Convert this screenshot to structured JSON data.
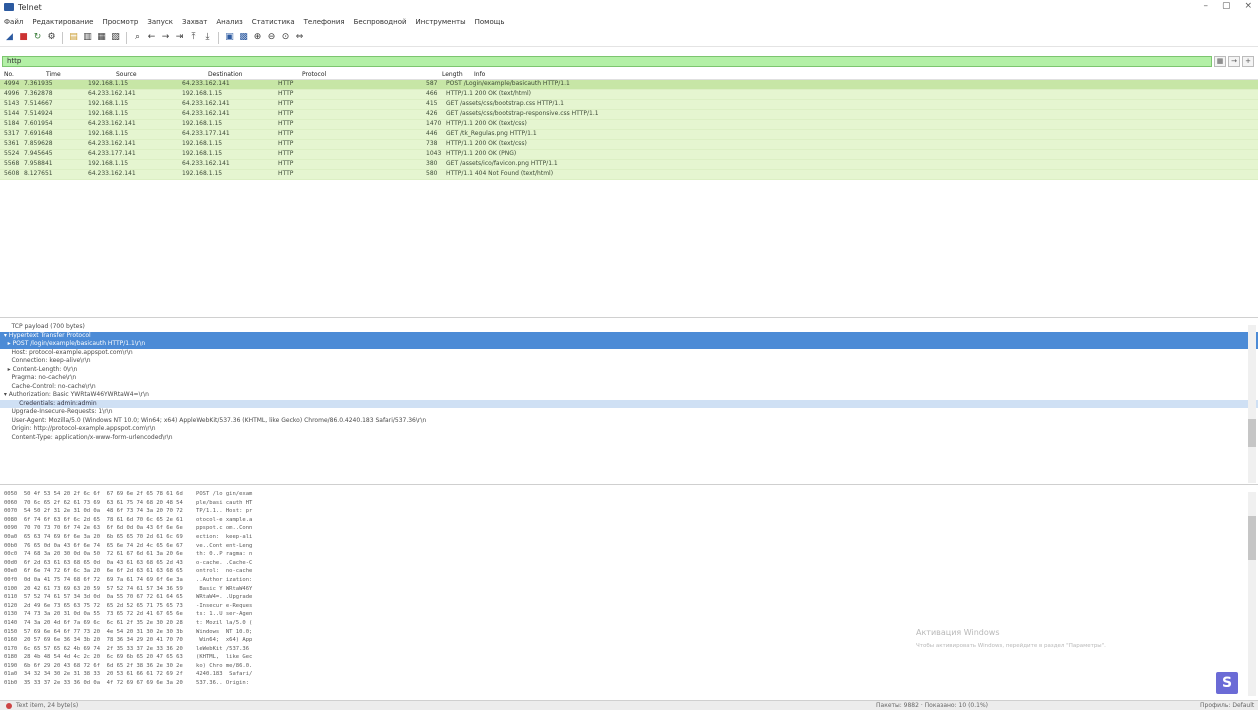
{
  "window": {
    "title": "Telnet",
    "controls": [
      "–",
      "▢",
      "×"
    ]
  },
  "menu": [
    "Файл",
    "Редактирование",
    "Просмотр",
    "Запуск",
    "Захват",
    "Анализ",
    "Статистика",
    "Телефония",
    "Беспроводной",
    "Инструменты",
    "Помощь"
  ],
  "toolbar": {
    "icons": [
      "shark-fin-icon",
      "stop-icon",
      "restart-icon",
      "options-icon",
      "open-icon",
      "save-icon",
      "close-file-icon",
      "reload-icon",
      "find-icon",
      "back-icon",
      "forward-icon",
      "goto-icon",
      "first-icon",
      "last-icon",
      "autoscroll-icon",
      "colorize-icon",
      "zoom-in-icon",
      "zoom-out-icon",
      "zoom-normal-icon",
      "resize-columns-icon"
    ]
  },
  "filter": {
    "value": "http",
    "buttons": [
      "▦",
      "→",
      "+"
    ]
  },
  "packet_list": {
    "columns": [
      "No.",
      "Time",
      "Source",
      "Destination",
      "Protocol",
      "Length",
      "Info"
    ],
    "rows": [
      {
        "no": "4994",
        "time": "7.361935",
        "src": "192.168.1.15",
        "dst": "64.233.162.141",
        "proto": "HTTP",
        "len": "587",
        "info": "POST /Login/example/basicauth HTTP/1.1"
      },
      {
        "no": "4996",
        "time": "7.362878",
        "src": "64.233.162.141",
        "dst": "192.168.1.15",
        "proto": "HTTP",
        "len": "466",
        "info": "HTTP/1.1 200 OK  (text/html)"
      },
      {
        "no": "5143",
        "time": "7.514667",
        "src": "192.168.1.15",
        "dst": "64.233.162.141",
        "proto": "HTTP",
        "len": "415",
        "info": "GET /assets/css/bootstrap.css HTTP/1.1"
      },
      {
        "no": "5144",
        "time": "7.514924",
        "src": "192.168.1.15",
        "dst": "64.233.162.141",
        "proto": "HTTP",
        "len": "426",
        "info": "GET /assets/css/bootstrap-responsive.css HTTP/1.1"
      },
      {
        "no": "5184",
        "time": "7.601954",
        "src": "64.233.162.141",
        "dst": "192.168.1.15",
        "proto": "HTTP",
        "len": "1470",
        "info": "HTTP/1.1 200 OK  (text/css)"
      },
      {
        "no": "5317",
        "time": "7.691648",
        "src": "192.168.1.15",
        "dst": "64.233.177.141",
        "proto": "HTTP",
        "len": "446",
        "info": "GET /tk_Regulas.png HTTP/1.1"
      },
      {
        "no": "5361",
        "time": "7.859628",
        "src": "64.233.162.141",
        "dst": "192.168.1.15",
        "proto": "HTTP",
        "len": "738",
        "info": "HTTP/1.1 200 OK  (text/css)"
      },
      {
        "no": "5524",
        "time": "7.945645",
        "src": "64.233.177.141",
        "dst": "192.168.1.15",
        "proto": "HTTP",
        "len": "1043",
        "info": "HTTP/1.1 200 OK  (PNG)"
      },
      {
        "no": "5568",
        "time": "7.958841",
        "src": "192.168.1.15",
        "dst": "64.233.162.141",
        "proto": "HTTP",
        "len": "380",
        "info": "GET /assets/ico/favicon.png HTTP/1.1"
      },
      {
        "no": "5608",
        "time": "8.127651",
        "src": "64.233.162.141",
        "dst": "192.168.1.15",
        "proto": "HTTP",
        "len": "580",
        "info": "HTTP/1.1 404 Not Found  (text/html)"
      }
    ]
  },
  "details": {
    "lines": [
      {
        "indent": "      ",
        "text": "TCP payload (700 bytes)",
        "cls": ""
      },
      {
        "indent": "  ▾ ",
        "text": "Hypertext Transfer Protocol",
        "cls": "hl"
      },
      {
        "indent": "    ▸ ",
        "text": "POST /login/example/basicauth HTTP/1.1\\r\\n",
        "cls": "hl"
      },
      {
        "indent": "      ",
        "text": "Host: protocol-example.appspot.com\\r\\n",
        "cls": ""
      },
      {
        "indent": "      ",
        "text": "Connection: keep-alive\\r\\n",
        "cls": ""
      },
      {
        "indent": "    ▸ ",
        "text": "Content-Length: 0\\r\\n",
        "cls": ""
      },
      {
        "indent": "      ",
        "text": "Pragma: no-cache\\r\\n",
        "cls": ""
      },
      {
        "indent": "      ",
        "text": "Cache-Control: no-cache\\r\\n",
        "cls": ""
      },
      {
        "indent": "  ▾ ",
        "text": "Authorization: Basic YWRtaW46YWRtaW4=\\r\\n",
        "cls": ""
      },
      {
        "indent": "          ",
        "text": "Credentials: admin:admin",
        "cls": "hl2"
      },
      {
        "indent": "      ",
        "text": "Upgrade-Insecure-Requests: 1\\r\\n",
        "cls": ""
      },
      {
        "indent": "      ",
        "text": "User-Agent: Mozilla/5.0 (Windows NT 10.0; Win64; x64) AppleWebKit/537.36 (KHTML, like Gecko) Chrome/86.0.4240.183 Safari/537.36\\r\\n",
        "cls": ""
      },
      {
        "indent": "      ",
        "text": "Origin: http://protocol-example.appspot.com\\r\\n",
        "cls": ""
      },
      {
        "indent": "      ",
        "text": "Content-Type: application/x-www-form-urlencoded\\r\\n",
        "cls": ""
      }
    ]
  },
  "bytes": {
    "lines": [
      "0050  50 4f 53 54 20 2f 6c 6f  67 69 6e 2f 65 78 61 6d    POST /lo gin/exam",
      "0060  70 6c 65 2f 62 61 73 69  63 61 75 74 68 20 48 54    ple/basi cauth HT",
      "0070  54 50 2f 31 2e 31 0d 0a  48 6f 73 74 3a 20 70 72    TP/1.1.. Host: pr",
      "0080  6f 74 6f 63 6f 6c 2d 65  78 61 6d 70 6c 65 2e 61    otocol-e xample.a",
      "0090  70 70 73 70 6f 74 2e 63  6f 6d 0d 0a 43 6f 6e 6e    ppspot.c om..Conn",
      "00a0  65 63 74 69 6f 6e 3a 20  6b 65 65 70 2d 61 6c 69    ection:  keep-ali",
      "00b0  76 65 0d 0a 43 6f 6e 74  65 6e 74 2d 4c 65 6e 67    ve..Cont ent-Leng",
      "00c0  74 68 3a 20 30 0d 0a 50  72 61 67 6d 61 3a 20 6e    th: 0..P ragma: n",
      "00d0  6f 2d 63 61 63 68 65 0d  0a 43 61 63 68 65 2d 43    o-cache. .Cache-C",
      "00e0  6f 6e 74 72 6f 6c 3a 20  6e 6f 2d 63 61 63 68 65    ontrol:  no-cache",
      "00f0  0d 0a 41 75 74 68 6f 72  69 7a 61 74 69 6f 6e 3a    ..Author ization:",
      "0100  20 42 61 73 69 63 20 59  57 52 74 61 57 34 36 59     Basic Y WRtaW46Y",
      "0110  57 52 74 61 57 34 3d 0d  0a 55 70 67 72 61 64 65    WRtaW4=. .Upgrade",
      "0120  2d 49 6e 73 65 63 75 72  65 2d 52 65 71 75 65 73    -Insecur e-Reques",
      "0130  74 73 3a 20 31 0d 0a 55  73 65 72 2d 41 67 65 6e    ts: 1..U ser-Agen",
      "0140  74 3a 20 4d 6f 7a 69 6c  6c 61 2f 35 2e 30 20 28    t: Mozil la/5.0 (",
      "0150  57 69 6e 64 6f 77 73 20  4e 54 20 31 30 2e 30 3b    Windows  NT 10.0;",
      "0160  20 57 69 6e 36 34 3b 20  78 36 34 29 20 41 70 70     Win64;  x64) App",
      "0170  6c 65 57 65 62 4b 69 74  2f 35 33 37 2e 33 36 20    leWebKit /537.36 ",
      "0180  28 4b 48 54 4d 4c 2c 20  6c 69 6b 65 20 47 65 63    (KHTML,  like Gec",
      "0190  6b 6f 29 20 43 68 72 6f  6d 65 2f 38 36 2e 30 2e    ko) Chro me/86.0.",
      "01a0  34 32 34 30 2e 31 38 33  20 53 61 66 61 72 69 2f    4240.183  Safari/",
      "01b0  35 33 37 2e 33 36 0d 0a  4f 72 69 67 69 6e 3a 20    537.36.. Origin: "
    ]
  },
  "watermark": {
    "title": "Активация Windows",
    "subtitle": "Чтобы активировать Windows, перейдите в раздел \"Параметры\"."
  },
  "corner_badge": "S",
  "status": {
    "left": "Text item, 24 byte(s)",
    "middle": "Пакеты: 9882 · Показано: 10 (0.1%)",
    "right": "Профиль: Default"
  }
}
